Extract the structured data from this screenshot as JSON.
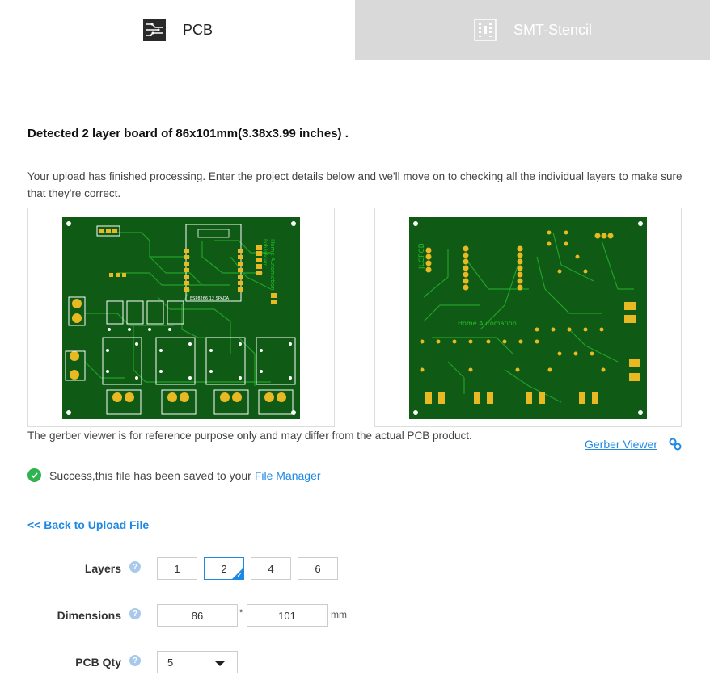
{
  "tabs": [
    {
      "label": "PCB",
      "icon": "pcb-icon",
      "active": true
    },
    {
      "label": "SMT-Stencil",
      "icon": "stencil-icon",
      "active": false
    }
  ],
  "detected_text": "Detected 2 layer board of 86x101mm(3.38x3.99 inches) .",
  "upload_message": "Your upload has finished processing. Enter the project details below and we'll move on to checking all the individual layers to make sure that they're correct.",
  "viewer": {
    "top_texts": {
      "title1": "Home Automation",
      "title2": "RobinBoard",
      "esp": "ESP8266 12 SPADA"
    },
    "bottom_texts": {
      "brand": "JLCPCB",
      "title": "Home Automation"
    },
    "reference_note": "The gerber viewer is for reference purpose only and may differ from the actual PCB product.",
    "gerber_link": "Gerber Viewer"
  },
  "success": {
    "message": "Success,this file has been saved to your",
    "link": "File Manager"
  },
  "back_link": "<< Back to Upload File",
  "form": {
    "layers_label": "Layers",
    "layers_options": [
      "1",
      "2",
      "4",
      "6"
    ],
    "layers_selected": "2",
    "dimensions_label": "Dimensions",
    "dim_x": "86",
    "dim_sep": "*",
    "dim_y": "101",
    "dim_unit": "mm",
    "qty_label": "PCB Qty",
    "qty_value": "5"
  },
  "colors": {
    "accent": "#1e88e5",
    "board": "#0f5a14",
    "pad": "#e8b923",
    "success": "#2fb34f",
    "inactive_tab": "#d9d9d9"
  }
}
